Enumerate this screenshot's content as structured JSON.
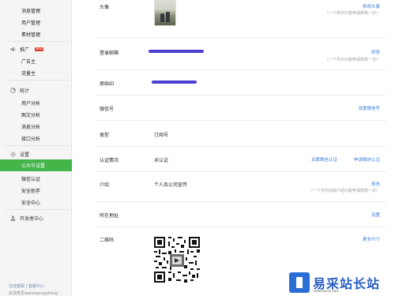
{
  "sidebar": {
    "top_items": [
      "消息管理",
      "用户管理",
      "素材管理"
    ],
    "ads_group": {
      "label": "推广",
      "badge": "NEW",
      "items": [
        "广告主",
        "流量主"
      ]
    },
    "stats_group": {
      "label": "统计",
      "items": [
        "用户分析",
        "图文分析",
        "消息分析",
        "接口分析"
      ]
    },
    "settings_group": {
      "label": "设置",
      "items": [
        "公众号设置",
        "微信认证",
        "安全助手",
        "安全中心"
      ],
      "active_index": 0
    },
    "dev_center": "开发者中心",
    "footer": {
      "line1_a": "在线客服",
      "line1_b": "客服中心",
      "line2": "反馈意见weixinpingzhong"
    }
  },
  "rows": [
    {
      "label": "头像",
      "value": "",
      "action": "修改头像",
      "note": "（一个月内只能申请修改一次）"
    },
    {
      "label": "登录邮箱",
      "value": "",
      "action": "修改",
      "note": "（一个月内只能申请修改一次）"
    },
    {
      "label": "原始ID",
      "value": "",
      "action": "",
      "note": ""
    },
    {
      "label": "微信号",
      "value": "",
      "action": "设置微信号",
      "note": ""
    },
    {
      "label": "类型",
      "value": "订阅号",
      "action": "",
      "note": ""
    },
    {
      "label": "认证情况",
      "value": "未认证",
      "action": "申请微信认证",
      "action2": "关联微信认证",
      "note": ""
    },
    {
      "label": "介绍",
      "value": "个人及公司宣传",
      "action": "修改",
      "note": "（一个月内功能介绍只能申请修改一次）"
    },
    {
      "label": "所在地址",
      "value": "",
      "action": "设置",
      "note": ""
    },
    {
      "label": "二维码",
      "value": "",
      "action": "更多尺寸",
      "note": ""
    }
  ],
  "watermark": {
    "title": "易采站长站",
    "subtitle": "www.easck.com"
  },
  "colors": {
    "sidebar_active": "#44b549",
    "link": "#3b7dd8",
    "redaction": "#4a3fd0",
    "watermark_blue": "#2b6fd6"
  },
  "icons": [
    "megaphone-icon",
    "chart-icon",
    "gear-icon",
    "user-icon",
    "qr-code-icon"
  ]
}
